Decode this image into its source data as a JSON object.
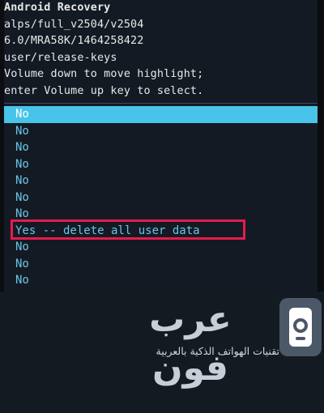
{
  "header": {
    "title": "Android Recovery",
    "lines": [
      "alps/full_v2504/v2504",
      "6.0/MRA58K/1464258422",
      "user/release-keys",
      "Volume down to move highlight;",
      "enter Volume up key to select."
    ]
  },
  "menu": {
    "items": [
      {
        "label": "No",
        "selected": true
      },
      {
        "label": "No"
      },
      {
        "label": "No"
      },
      {
        "label": "No"
      },
      {
        "label": "No"
      },
      {
        "label": "No"
      },
      {
        "label": "No"
      },
      {
        "label": "Yes -- delete all user data",
        "annotated": true
      },
      {
        "label": "No"
      },
      {
        "label": "No"
      },
      {
        "label": "No"
      }
    ]
  },
  "colors": {
    "background": "#141a24",
    "menu_text": "#68c6e6",
    "selection": "#48c3ea",
    "annotation": "#e41c4c"
  },
  "watermark": {
    "brand": "عرب فون",
    "tagline": "تقنيات الهواتف الذكية بالعربية",
    "logo_icon": "arabphone-logo-icon"
  }
}
